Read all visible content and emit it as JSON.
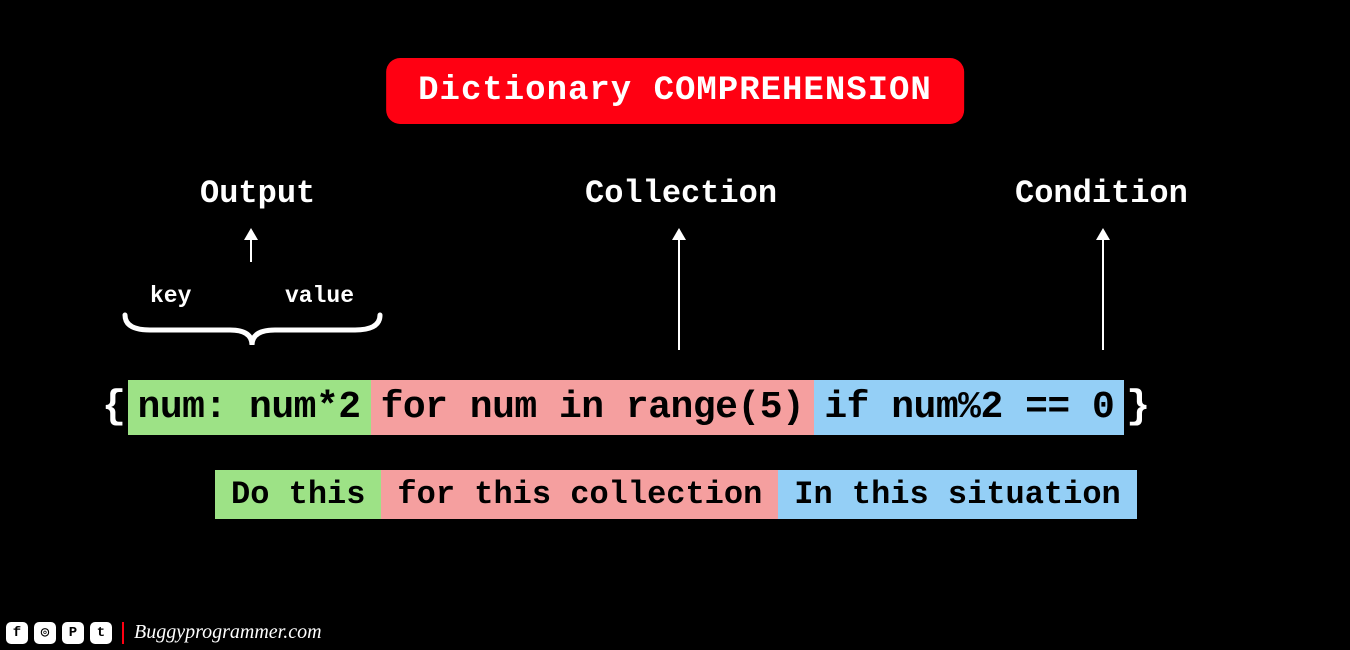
{
  "title": "Dictionary COMPREHENSION",
  "headings": {
    "output": "Output",
    "collection": "Collection",
    "condition": "Condition"
  },
  "kv": {
    "key_label": "key",
    "value_label": "value"
  },
  "code": {
    "open_brace": "{",
    "close_brace": "}",
    "output_segment": "num: num*2",
    "collection_segment": " for num in range(5)",
    "condition_segment": " if num%2 == 0"
  },
  "captions": {
    "output": "Do this",
    "collection": " for this collection",
    "condition": "In this situation"
  },
  "footer": {
    "brand": "Buggyprogrammer.com",
    "socials": [
      "f",
      "◎",
      "P",
      "t"
    ]
  },
  "colors": {
    "bg": "#000000",
    "title_bg": "#ff0012",
    "green": "#9de286",
    "pink": "#f59f9f",
    "blue": "#94cff6"
  }
}
